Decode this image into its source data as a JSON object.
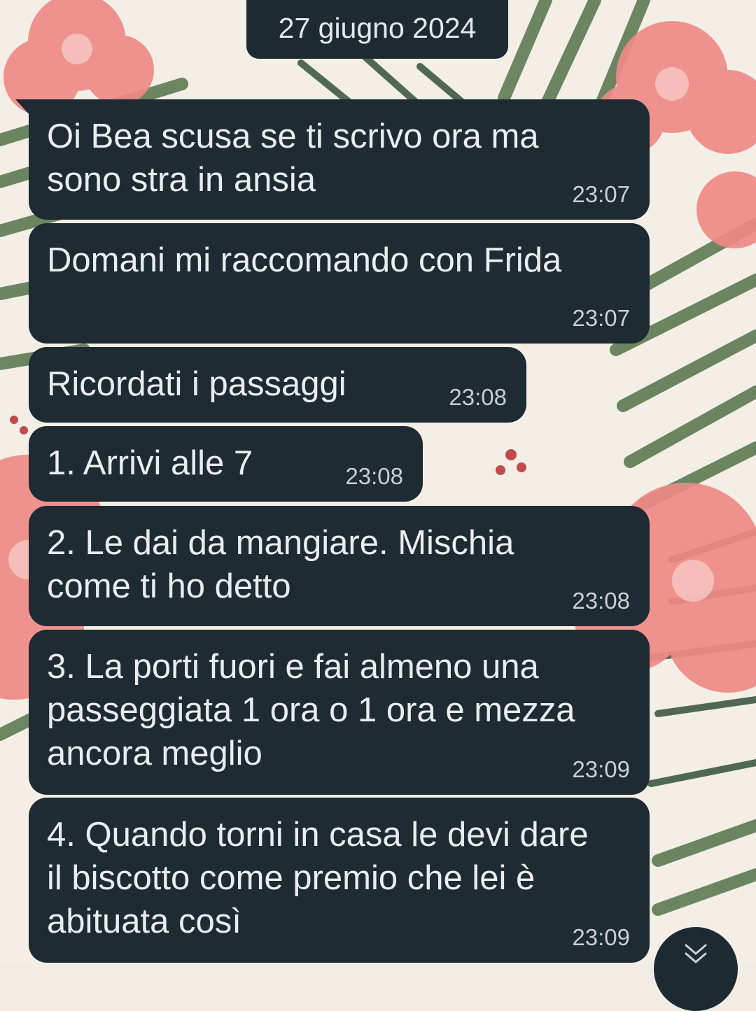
{
  "chat": {
    "date_divider": "27 giugno 2024",
    "messages": [
      {
        "text": "Oi Bea scusa se ti scrivo ora ma\nsono stra in ansia",
        "time": "23:07"
      },
      {
        "text": "Domani mi raccomando con Frida",
        "time": "23:07"
      },
      {
        "text": "Ricordati i passaggi",
        "time": "23:08"
      },
      {
        "text": "1. Arrivi alle 7",
        "time": "23:08"
      },
      {
        "text": "2. Le dai da mangiare. Mischia\ncome ti ho detto",
        "time": "23:08"
      },
      {
        "text": "3. La porti fuori e fai almeno una\npasseggiata 1 ora o 1 ora e mezza\nancora meglio",
        "time": "23:09"
      },
      {
        "text": "4. Quando torni in casa le devi dare\nil biscotto come premio che lei è\nabituata così",
        "time": "23:09"
      }
    ]
  },
  "controls": {
    "scroll_down_icon": "double-chevron-down-icon"
  },
  "colors": {
    "bubble_bg": "#1f2b32",
    "bubble_text": "#e9edef",
    "time_text": "#c8ced2",
    "wallpaper_leaf": "#5d7a52",
    "wallpaper_flower": "#ef8a86"
  }
}
